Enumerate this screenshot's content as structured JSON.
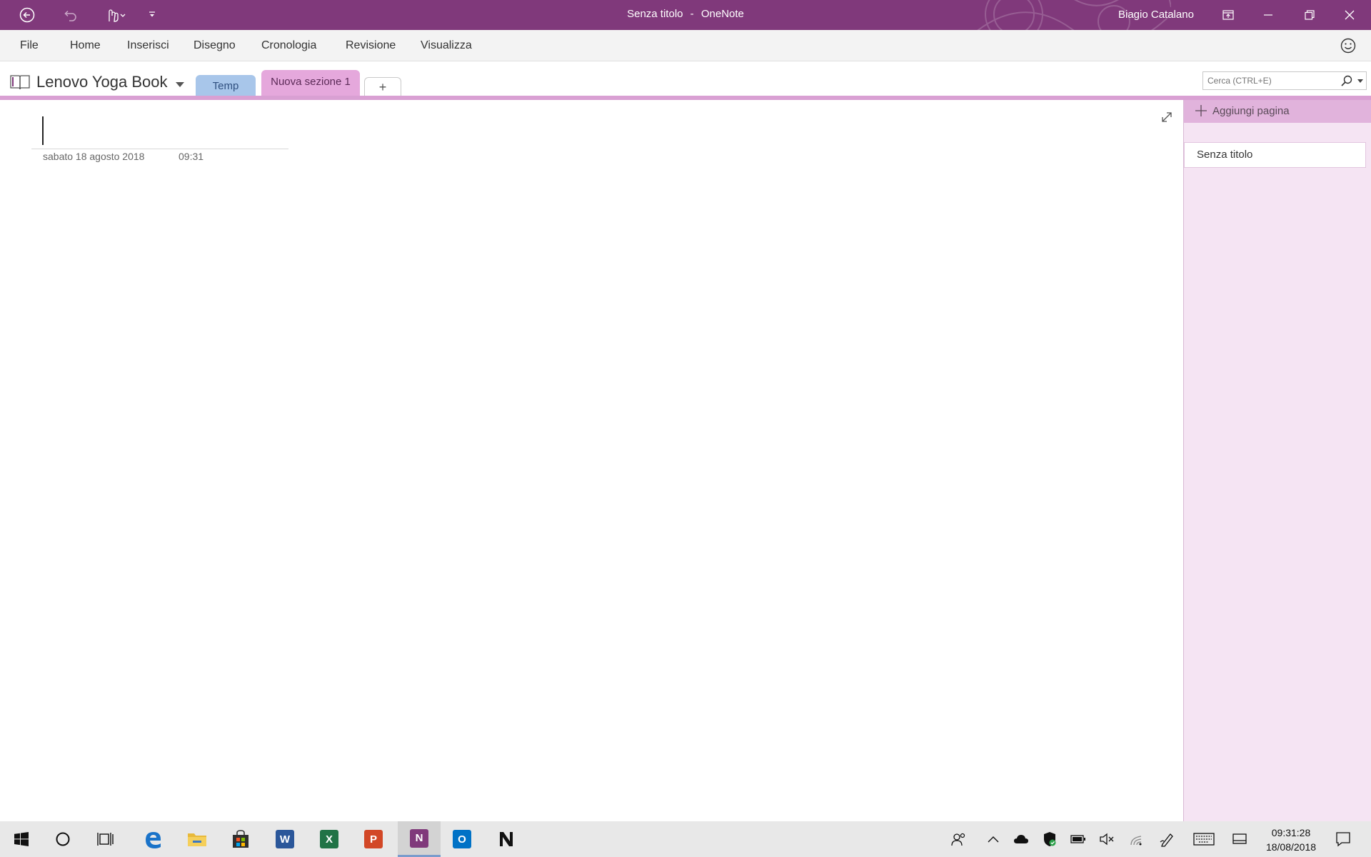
{
  "window": {
    "doc_title": "Senza titolo",
    "separator": "-",
    "app_name": "OneNote",
    "user_name": "Biagio Catalano",
    "accent": "#80397b"
  },
  "ribbon": {
    "tabs": [
      "File",
      "Home",
      "Inserisci",
      "Disegno",
      "Cronologia",
      "Revisione",
      "Visualizza"
    ]
  },
  "notebook": {
    "name": "Lenovo Yoga Book",
    "sections": [
      {
        "label": "Temp",
        "color": "#a8c6ea"
      },
      {
        "label": "Nuova sezione 1",
        "color": "#e5a8dc",
        "active": true
      }
    ],
    "add_section_label": "+"
  },
  "search": {
    "placeholder": "Cerca (CTRL+E)"
  },
  "page": {
    "date": "sabato 18 agosto 2018",
    "time": "09:31"
  },
  "page_list": {
    "add_page_label": "Aggiungi pagina",
    "pages": [
      "Senza titolo"
    ]
  },
  "taskbar": {
    "apps": [
      "start-icon",
      "cortana-icon",
      "task-view-icon",
      "edge-icon",
      "file-explorer-icon",
      "store-icon",
      "word-icon",
      "excel-icon",
      "powerpoint-icon",
      "onenote-icon",
      "outlook-icon",
      "notion-icon"
    ],
    "clock_time": "09:31:28",
    "clock_date": "18/08/2018"
  }
}
